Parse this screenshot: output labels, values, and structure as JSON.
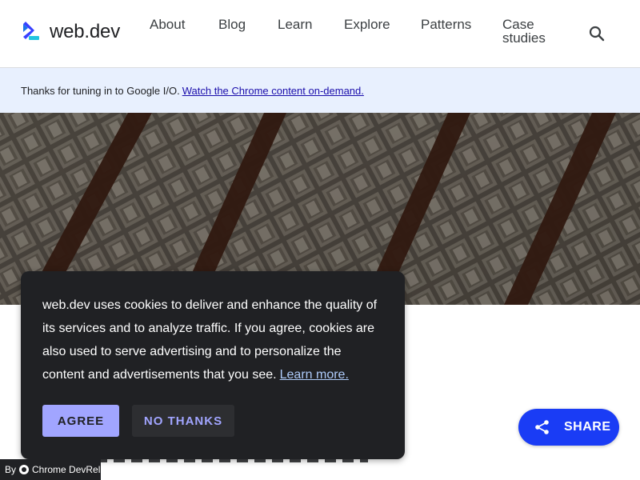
{
  "header": {
    "logo_text": "web.dev",
    "nav": [
      {
        "label": "About"
      },
      {
        "label": "Blog"
      },
      {
        "label": "Learn"
      },
      {
        "label": "Explore"
      },
      {
        "label": "Patterns"
      },
      {
        "label": "Case studies"
      }
    ],
    "search_icon": "search-icon"
  },
  "banner": {
    "text": "Thanks for tuning in to Google I/O.",
    "link_text": "Watch the Chrome content on-demand."
  },
  "cookie": {
    "text": "web.dev uses cookies to deliver and enhance the quality of its services and to analyze traffic. If you agree, cookies are also used to serve advertising and to personalize the content and advertisements that you see.",
    "link_text": "Learn more.",
    "agree_label": "AGREE",
    "no_thanks_label": "NO THANKS"
  },
  "share": {
    "label": "SHARE",
    "icon": "share-icon"
  },
  "footer_badge": {
    "prefix": "By",
    "label": "Chrome DevRel"
  },
  "colors": {
    "accent": "#1a3cf5",
    "cookie_bg": "#202124",
    "agree_bg": "#a1a5ff",
    "banner_bg": "#e8f0fe"
  }
}
